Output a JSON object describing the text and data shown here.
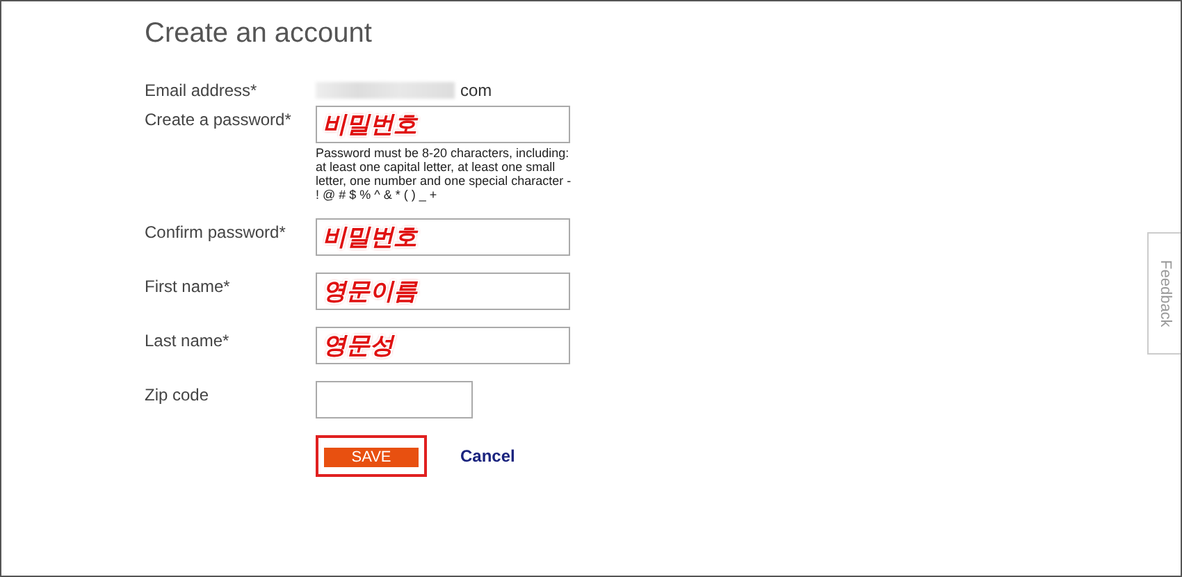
{
  "title": "Create an account",
  "fields": [
    {
      "kind": "email",
      "label": "Email address*",
      "value": "com"
    },
    {
      "kind": "input",
      "label": "Create a password*",
      "value": "비밀번호",
      "hint": "Password must be 8-20 characters, including: at least one capital letter, at least one small letter, one number and one special character - ! @ # $ % ^ & * ( ) _ +"
    },
    {
      "kind": "input",
      "label": "Confirm password*",
      "value": "비밀번호"
    },
    {
      "kind": "input",
      "label": "First name*",
      "value": "영문이름"
    },
    {
      "kind": "input",
      "label": "Last name*",
      "value": "영문성"
    },
    {
      "kind": "short-input",
      "label": "Zip code"
    }
  ],
  "save": {
    "label": "SAVE",
    "highlighted": true
  },
  "cancel": "Cancel",
  "feedback": "Feedback"
}
